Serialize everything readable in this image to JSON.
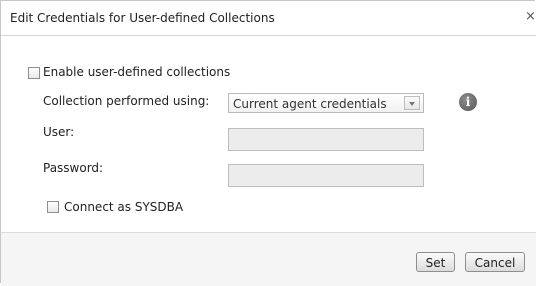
{
  "dialog": {
    "title": "Edit Credentials for User-defined Collections",
    "close_glyph": "×"
  },
  "form": {
    "enable_label": "Enable user-defined collections",
    "enable_checked": false,
    "collection_label": "Collection performed using:",
    "collection_value": "Current agent credentials",
    "user_label": "User:",
    "user_value": "",
    "password_label": "Password:",
    "password_value": "",
    "sysdba_label": "Connect as SYSDBA",
    "sysdba_checked": false,
    "info_glyph": "i"
  },
  "buttons": {
    "set_label": "Set",
    "cancel_label": "Cancel"
  }
}
